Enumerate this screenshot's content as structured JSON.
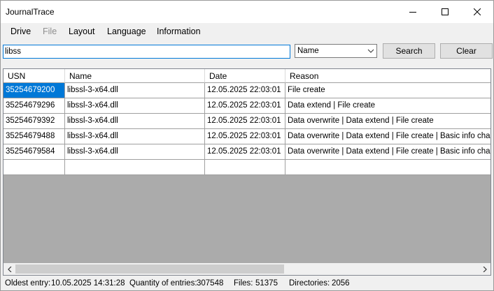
{
  "window": {
    "title": "JournalTrace"
  },
  "menu": {
    "items": [
      {
        "label": "Drive",
        "enabled": true
      },
      {
        "label": "File",
        "enabled": false
      },
      {
        "label": "Layout",
        "enabled": true
      },
      {
        "label": "Language",
        "enabled": true
      },
      {
        "label": "Information",
        "enabled": true
      }
    ]
  },
  "search": {
    "value": "libss",
    "field_selected": "Name",
    "search_label": "Search",
    "clear_label": "Clear"
  },
  "table": {
    "columns": [
      "USN",
      "Name",
      "Date",
      "Reason"
    ],
    "rows": [
      {
        "usn": "35254679200",
        "name": "libssl-3-x64.dll",
        "date": "12.05.2025 22:03:01",
        "reason": "File create"
      },
      {
        "usn": "35254679296",
        "name": "libssl-3-x64.dll",
        "date": "12.05.2025 22:03:01",
        "reason": "Data extend | File create"
      },
      {
        "usn": "35254679392",
        "name": "libssl-3-x64.dll",
        "date": "12.05.2025 22:03:01",
        "reason": "Data overwrite | Data extend | File create"
      },
      {
        "usn": "35254679488",
        "name": "libssl-3-x64.dll",
        "date": "12.05.2025 22:03:01",
        "reason": "Data overwrite | Data extend | File create | Basic info change"
      },
      {
        "usn": "35254679584",
        "name": "libssl-3-x64.dll",
        "date": "12.05.2025 22:03:01",
        "reason": "Data overwrite | Data extend | File create | Basic info chang..."
      }
    ]
  },
  "status": {
    "oldest_label": "Oldest entry:",
    "oldest_value": "10.05.2025 14:31:28",
    "quantity_label": "Quantity of entries:",
    "quantity_value": "307548",
    "files_label": "Files:",
    "files_value": "51375",
    "dirs_label": "Directories:",
    "dirs_value": "2056"
  },
  "colors": {
    "selection": "#0078d7",
    "grid_background": "#ababab",
    "window_background": "#f0f0f0"
  }
}
